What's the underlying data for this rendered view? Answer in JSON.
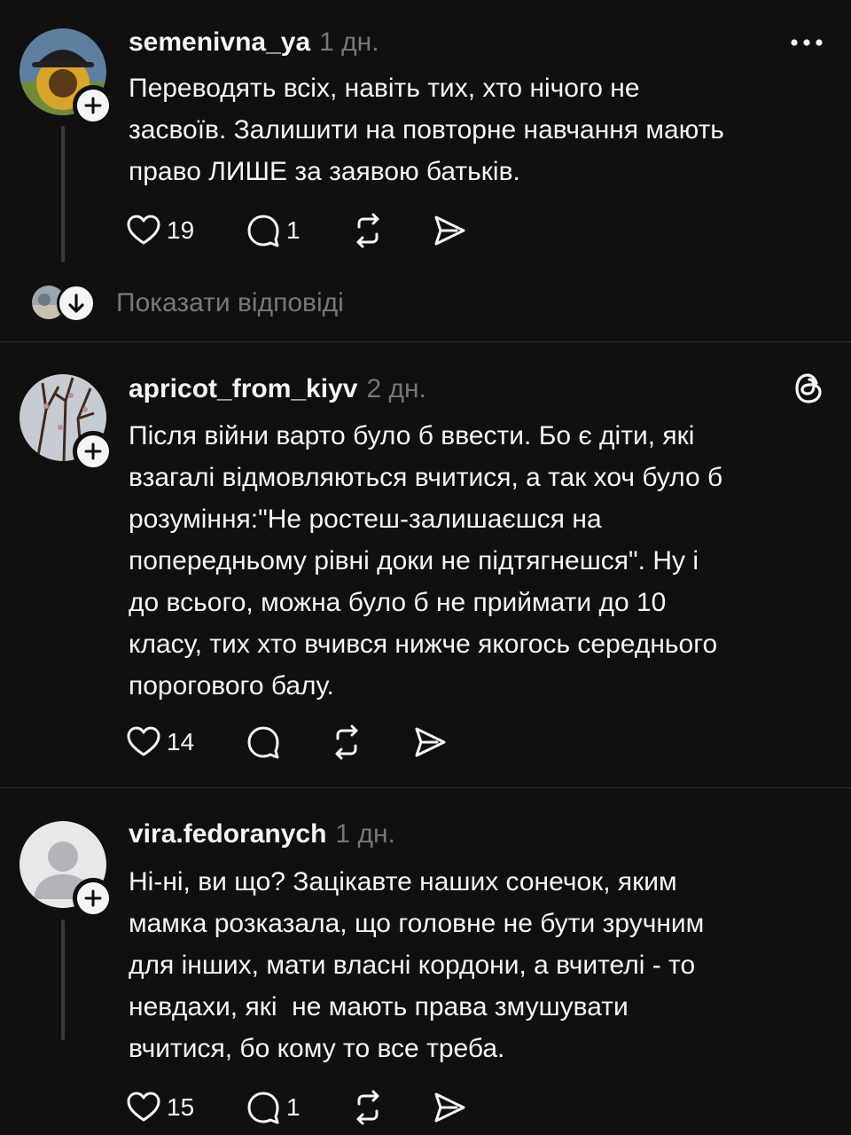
{
  "posts": [
    {
      "username": "semenivna_ya",
      "time": "1 дн.",
      "text": "Переводять всіх, навіть тих, хто нічого не\nзасвоїв. Залишити на повторне навчання мають\nправо ЛИШЕ за заявою батьків.",
      "likes": "19",
      "replies": "1"
    },
    {
      "username": "apricot_from_kiyv",
      "time": "2 дн.",
      "text": "Після війни варто було б ввести. Бо є діти, які\nвзагалі відмовляються вчитися, а так хоч було б\nрозуміння:\"Не ростеш-залишаєшся на\nпопередньому рівні доки не підтягнешся\". Ну і\nдо всього, можна було б не приймати до 10\nкласу, тих хто вчився нижче якогось середнього\nпорогового балу.",
      "likes": "14",
      "replies": ""
    },
    {
      "username": "vira.fedoranych",
      "time": "1 дн.",
      "text": "Ні-ні, ви що? Зацікавте наших сонечок, яким\nмамка розказала, що головне не бути зручним\nдля інших, мати власні кордони, а вчителі - то\nневдахи, які  не мають права змушувати\nвчитися, бо кому то все треба.",
      "likes": "15",
      "replies": "1"
    }
  ],
  "show_replies_label": "Показати відповіді",
  "icons": {
    "more": "more-horizontal-icon",
    "threads": "threads-logo-icon",
    "like": "heart-icon",
    "reply": "comment-icon",
    "repost": "repost-icon",
    "share": "send-icon",
    "follow": "plus-icon",
    "expand": "arrow-down-icon"
  },
  "colors": {
    "background": "#101010",
    "text": "#f3f5f7",
    "secondary": "#777777",
    "divider": "#2e2e2e"
  }
}
